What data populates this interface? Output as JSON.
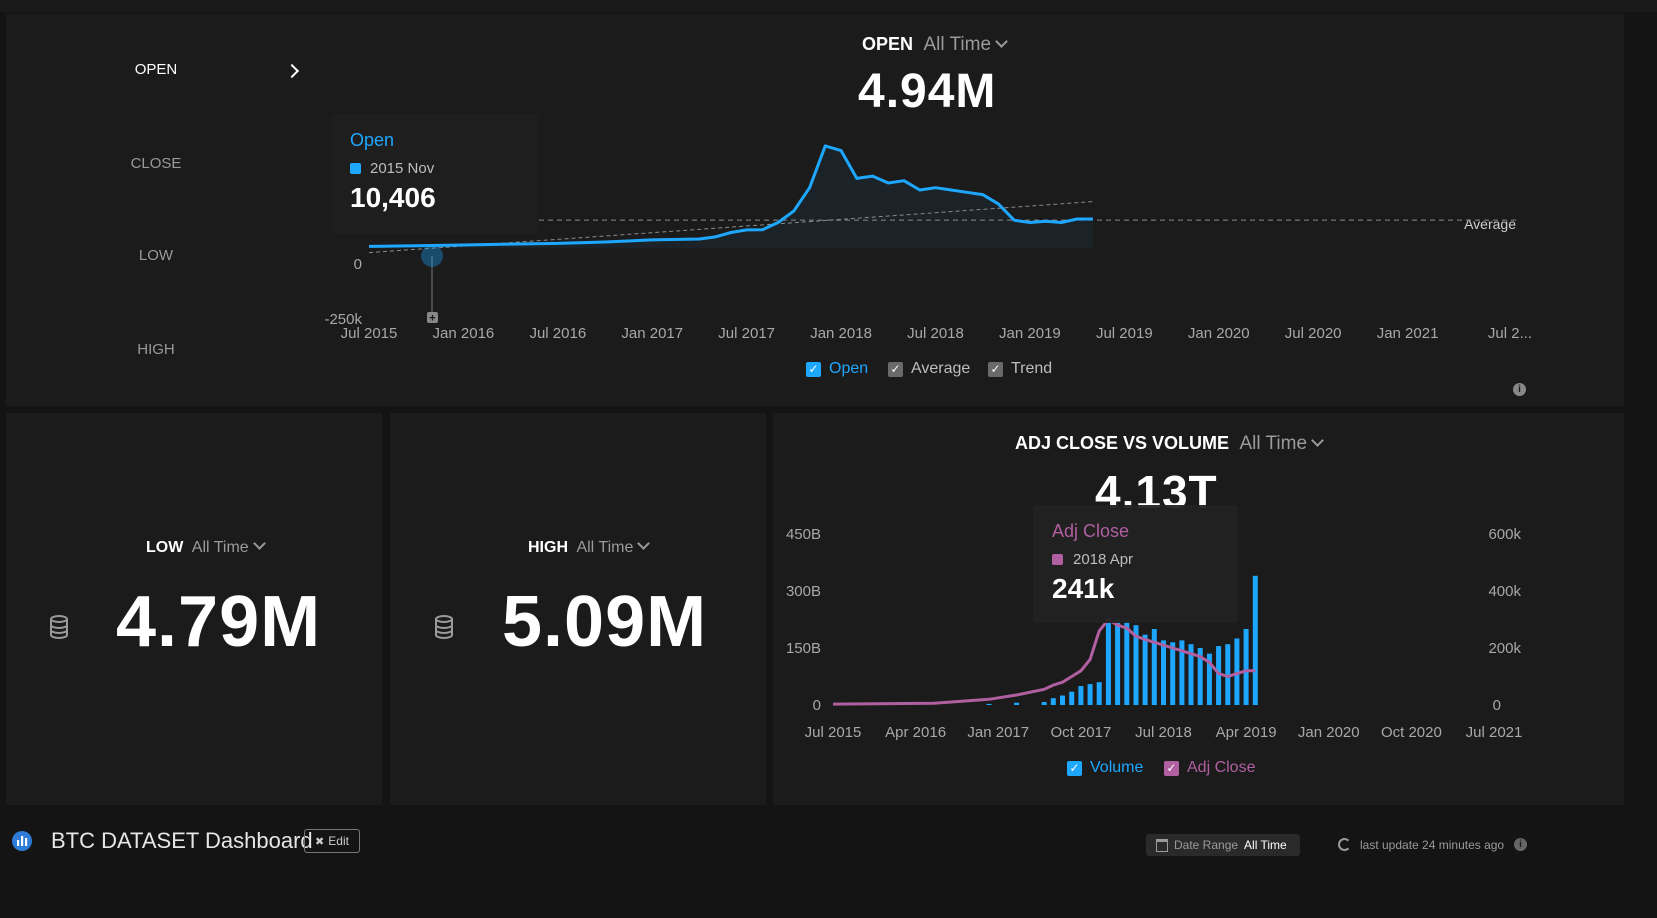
{
  "nav": {
    "items": [
      {
        "label": "OPEN"
      },
      {
        "label": "CLOSE"
      },
      {
        "label": "LOW"
      },
      {
        "label": "HIGH"
      }
    ]
  },
  "open_panel": {
    "title": "OPEN",
    "period": "All Time",
    "value": "4.94M",
    "y_ticks": [
      "0",
      "-250k"
    ],
    "average_label": "Average",
    "tooltip": {
      "series": "Open",
      "period": "2015 Nov",
      "value": "10,406"
    },
    "legend": [
      {
        "label": "Open",
        "color": "#1ea7ff"
      },
      {
        "label": "Average",
        "color": "#6a6a6a"
      },
      {
        "label": "Trend",
        "color": "#6a6a6a"
      }
    ]
  },
  "low_panel": {
    "title": "LOW",
    "period": "All Time",
    "value": "4.79M"
  },
  "high_panel": {
    "title": "HIGH",
    "period": "All Time",
    "value": "5.09M"
  },
  "adj_panel": {
    "title": "ADJ CLOSE VS VOLUME",
    "period": "All Time",
    "value": "4.13T",
    "y_left": [
      "450B",
      "300B",
      "150B",
      "0"
    ],
    "y_right": [
      "600k",
      "400k",
      "200k",
      "0"
    ],
    "tooltip": {
      "series": "Adj Close",
      "period": "2018 Apr",
      "value": "241k"
    },
    "legend": [
      {
        "label": "Volume",
        "color": "#1ea7ff"
      },
      {
        "label": "Adj Close",
        "color": "#b05fa0"
      }
    ]
  },
  "footer": {
    "title": "BTC DATASET Dashboard",
    "edit_label": "Edit",
    "date_range_label": "Date Range",
    "date_range_value": "All Time",
    "last_update": "last update 24 minutes ago"
  },
  "chart_data": [
    {
      "type": "line",
      "title": "OPEN",
      "x_ticks": [
        "Jul 2015",
        "Jan 2016",
        "Jul 2016",
        "Jan 2017",
        "Jul 2017",
        "Jan 2018",
        "Jul 2018",
        "Jan 2019",
        "Jul 2019",
        "Jan 2020",
        "Jul 2020",
        "Jan 2021",
        "Jul 2..."
      ],
      "x": [
        "2015-07",
        "2015-10",
        "2016-01",
        "2016-04",
        "2016-07",
        "2016-10",
        "2017-01",
        "2017-04",
        "2017-05",
        "2017-06",
        "2017-07",
        "2017-08",
        "2017-09",
        "2017-10",
        "2017-11",
        "2017-12",
        "2018-01",
        "2018-02",
        "2018-03",
        "2018-04",
        "2018-05",
        "2018-06",
        "2018-07",
        "2018-08",
        "2018-09",
        "2018-10",
        "2018-11",
        "2018-12",
        "2019-01",
        "2019-02",
        "2019-03",
        "2019-04",
        "2019-05"
      ],
      "series": [
        {
          "name": "Open",
          "color": "#1ea7ff",
          "values": [
            7000,
            10000,
            13000,
            17000,
            20000,
            26000,
            35000,
            39000,
            48000,
            67000,
            78000,
            79000,
            110000,
            160000,
            260000,
            440000,
            420000,
            300000,
            310000,
            280000,
            290000,
            250000,
            260000,
            250000,
            240000,
            230000,
            190000,
            120000,
            110000,
            115000,
            110000,
            125000,
            125000
          ]
        }
      ],
      "average": 120000,
      "trend": {
        "start": -20000,
        "end": 200000
      },
      "ylim": [
        -250000,
        650000
      ],
      "legend": [
        "Open",
        "Average",
        "Trend"
      ]
    },
    {
      "type": "bar",
      "title": "ADJ CLOSE VS VOLUME",
      "x_ticks": [
        "Jul 2015",
        "Apr 2016",
        "Jan 2017",
        "Oct 2017",
        "Jul 2018",
        "Apr 2019",
        "Jan 2020",
        "Oct 2020",
        "Jul 2021"
      ],
      "x": [
        "2016-12",
        "2017-03",
        "2017-06",
        "2017-07",
        "2017-08",
        "2017-09",
        "2017-10",
        "2017-11",
        "2017-12",
        "2018-01",
        "2018-02",
        "2018-03",
        "2018-04",
        "2018-05",
        "2018-06",
        "2018-07",
        "2018-08",
        "2018-09",
        "2018-10",
        "2018-11",
        "2018-12",
        "2019-01",
        "2019-02",
        "2019-03",
        "2019-04",
        "2019-05"
      ],
      "series": [
        {
          "name": "Volume",
          "color": "#1ea7ff",
          "axis": "left",
          "values": [
            3,
            6,
            8,
            18,
            25,
            35,
            50,
            55,
            60,
            230,
            225,
            220,
            210,
            185,
            200,
            170,
            165,
            170,
            160,
            150,
            135,
            155,
            160,
            175,
            200,
            340
          ]
        },
        {
          "name": "Adj Close",
          "color": "#b05fa0",
          "axis": "right",
          "values": [
            20000,
            35000,
            55000,
            70000,
            80000,
            100000,
            120000,
            160000,
            260000,
            300000,
            280000,
            270000,
            241000,
            230000,
            220000,
            210000,
            200000,
            190000,
            180000,
            170000,
            150000,
            110000,
            100000,
            110000,
            120000,
            120000
          ]
        }
      ],
      "ylim_left": [
        0,
        450
      ],
      "ylim_right": [
        0,
        600000
      ],
      "legend": [
        "Volume",
        "Adj Close"
      ]
    }
  ]
}
